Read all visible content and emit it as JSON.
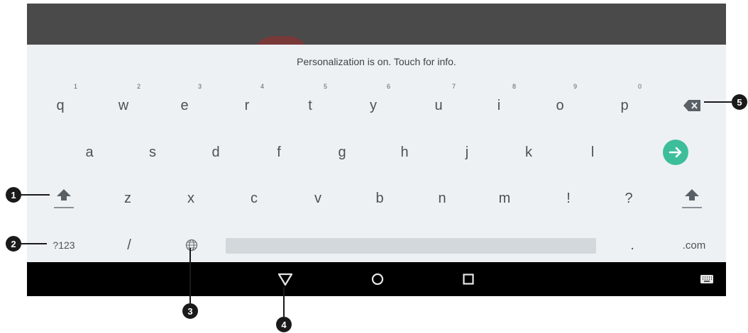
{
  "suggestion": "Personalization is on. Touch for info.",
  "row1": [
    {
      "key": "q",
      "hint": "1"
    },
    {
      "key": "w",
      "hint": "2"
    },
    {
      "key": "e",
      "hint": "3"
    },
    {
      "key": "r",
      "hint": "4"
    },
    {
      "key": "t",
      "hint": "5"
    },
    {
      "key": "y",
      "hint": "6"
    },
    {
      "key": "u",
      "hint": "7"
    },
    {
      "key": "i",
      "hint": "8"
    },
    {
      "key": "o",
      "hint": "9"
    },
    {
      "key": "p",
      "hint": "0"
    }
  ],
  "row2": [
    "a",
    "s",
    "d",
    "f",
    "g",
    "h",
    "j",
    "k",
    "l"
  ],
  "row3": [
    "z",
    "x",
    "c",
    "v",
    "b",
    "n",
    "m",
    "!",
    "?"
  ],
  "bottom": {
    "symbols": "?123",
    "slash": "/",
    "period": ".",
    "dotcom": ".com"
  },
  "icons": {
    "shift_left": "shift-icon",
    "shift_right": "shift-icon",
    "backspace": "backspace-icon",
    "enter": "enter-arrow-icon",
    "globe": "globe-icon",
    "back": "back-triangle-icon",
    "home": "home-circle-icon",
    "recents": "recents-square-icon",
    "keyboard": "keyboard-icon"
  },
  "colors": {
    "accent": "#3dbe9a",
    "keyboard_bg": "#edf1f4",
    "nav_bg": "#000000"
  },
  "callouts": [
    "1",
    "2",
    "3",
    "4",
    "5"
  ]
}
